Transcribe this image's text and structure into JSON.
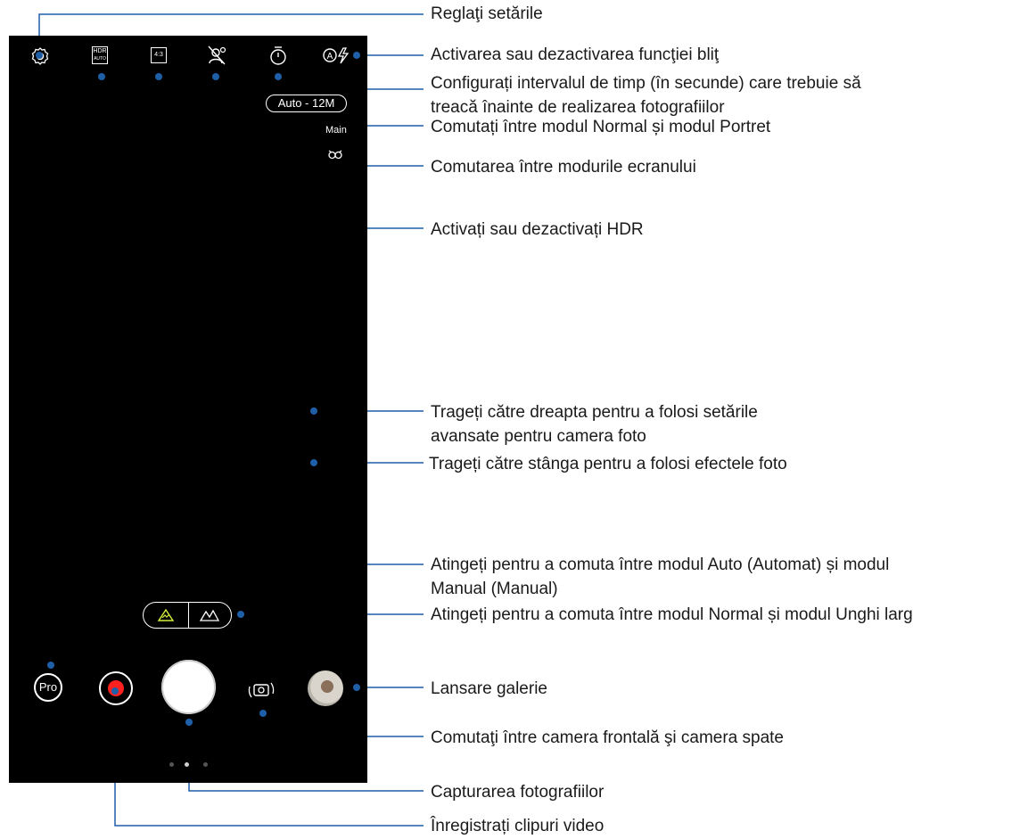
{
  "camera_ui": {
    "resolution_label": "Auto - 12M",
    "lens_label": "Main",
    "pro_label": "Pro",
    "hdr_label_top": "HDR",
    "hdr_label_bottom": "AUTO",
    "ratio_label": "4:3",
    "pager_active_index": 1,
    "colors": {
      "background": "#000000",
      "record": "#ff2020",
      "callout": "#1f5fa8"
    },
    "icons": [
      "settings-gear-icon",
      "hdr-auto-icon",
      "aspect-ratio-icon",
      "portrait-mode-icon",
      "timer-icon",
      "flash-auto-icon",
      "owl-icon",
      "wide-angle-mountain-icon",
      "switch-camera-icon"
    ]
  },
  "callouts": {
    "settings": "Reglaţi setările",
    "flash": "Activarea sau dezactivarea funcţiei bliţ",
    "timer_line1": "Configurați intervalul de timp (în secunde) care trebuie să",
    "timer_line2": "treacă înainte de realizarea fotografiilor",
    "portrait": "Comutați între modul Normal și modul Portret",
    "ratio": "Comutarea între modurile ecranului",
    "hdr": "Activați sau dezactivați HDR",
    "swipe_right_line1": "Trageți către dreapta pentru a folosi setările",
    "swipe_right_line2": "avansate pentru camera foto",
    "swipe_left": "Trageți către stânga pentru a folosi efectele foto",
    "pro_line1": "Atingeți pentru a comuta între modul Auto (Automat) și modul",
    "pro_line2": "Manual (Manual)",
    "wide": "Atingeți pentru a comuta între modul Normal și modul Unghi larg",
    "gallery": "Lansare galerie",
    "switch_camera": "Comutaţi între camera frontală şi camera spate",
    "capture": "Capturarea fotografiilor",
    "video": "Înregistrați clipuri video"
  }
}
